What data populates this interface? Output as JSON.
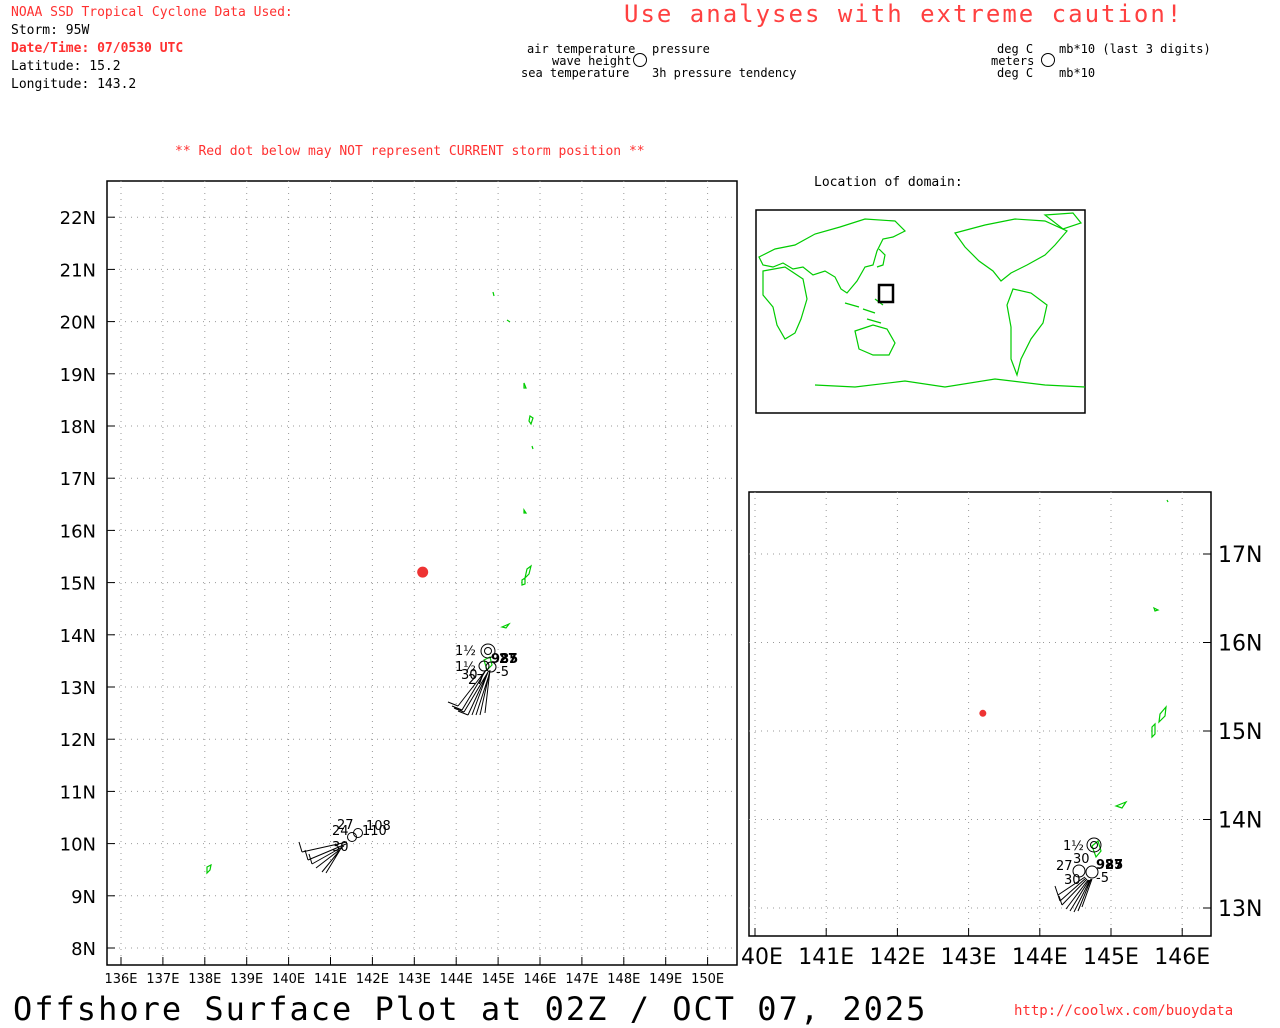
{
  "header": {
    "source": "NOAA SSD Tropical Cyclone Data Used:",
    "storm": "Storm: 95W",
    "datetime": "Date/Time: 07/0530 UTC",
    "latitude": "Latitude: 15.2",
    "longitude": "Longitude: 143.2",
    "warning": "Use analyses with extreme caution!",
    "red_dot_note": "** Red dot below may NOT represent CURRENT storm position **"
  },
  "legend": {
    "left_1": "air temperature",
    "left_2": "wave height",
    "left_3": "sea temperature",
    "right_1": "pressure",
    "right_2": "3h pressure tendency",
    "unit_l1": "deg C",
    "unit_l2": "meters",
    "unit_l3": "deg C",
    "unit_r1": "mb*10 (last 3 digits)",
    "unit_r3": "mb*10"
  },
  "inset": {
    "title": "Location of domain:"
  },
  "main_map": {
    "lat_labels": [
      "8N",
      "9N",
      "10N",
      "11N",
      "12N",
      "13N",
      "14N",
      "15N",
      "16N",
      "17N",
      "18N",
      "19N",
      "20N",
      "21N",
      "22N"
    ],
    "lon_labels": [
      "136E",
      "137E",
      "138E",
      "139E",
      "140E",
      "141E",
      "142E",
      "143E",
      "144E",
      "145E",
      "146E",
      "147E",
      "148E",
      "149E",
      "150E"
    ],
    "storm_lat": 15.2,
    "storm_lon": 143.2,
    "obs_text": {
      "n1": "1½",
      "n2": "1½",
      "n3": "30",
      "n4": "27",
      "n5": "985",
      "n6": "27",
      "n7": "-5",
      "n8": "27",
      "n9": "24",
      "n10": "108",
      "n11": "110",
      "n12": "30"
    }
  },
  "zoom_map": {
    "lat_labels": [
      "13N",
      "14N",
      "15N",
      "16N",
      "17N"
    ],
    "lon_labels": [
      "140E",
      "141E",
      "142E",
      "143E",
      "144E",
      "145E",
      "146E"
    ],
    "obs_text": {
      "n1": "1½",
      "n2": "30",
      "n3": "27",
      "n4": "985",
      "n5": "27",
      "n6": "30",
      "n7": "-5"
    }
  },
  "footer": {
    "title": "Offshore Surface Plot at 02Z / OCT 07, 2025",
    "url": "http://coolwx.com/buoydata"
  },
  "colors": {
    "storm_dot": "#ee3333",
    "coastline": "#00cc00",
    "warning": "#ff4040"
  }
}
